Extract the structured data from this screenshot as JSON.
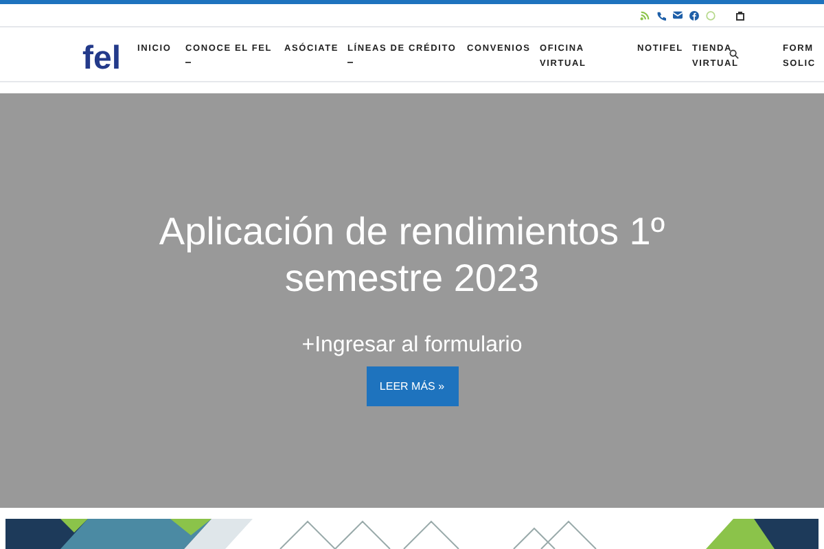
{
  "nav": {
    "items": [
      {
        "label": "INICIO",
        "dropdown": false
      },
      {
        "label": "CONOCE EL FEL",
        "dropdown": true
      },
      {
        "label": "ASÓCIATE",
        "dropdown": false
      },
      {
        "label": "LÍNEAS DE CRÉDITO",
        "dropdown": true
      },
      {
        "label": "CONVENIOS",
        "dropdown": false
      },
      {
        "label": "OFICINA VIRTUAL",
        "dropdown": false
      },
      {
        "label": "NOTIFEL",
        "dropdown": false
      },
      {
        "label": "TIENDA VIRTUAL",
        "dropdown": false
      },
      {
        "label": "FORM SOLIC",
        "dropdown": false
      }
    ]
  },
  "logo": {
    "text": "fel"
  },
  "hero": {
    "title": "Aplicación de rendimientos 1º semestre 2023",
    "subtitle": "+Ingresar al formulario",
    "button": "LEER MÁS »"
  }
}
